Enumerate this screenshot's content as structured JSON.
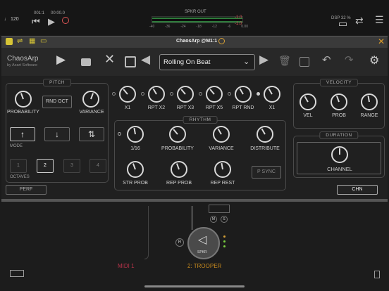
{
  "transport": {
    "tempo": "♩ 120",
    "bar_readout": "001:1",
    "time_readout": "00:00.0",
    "meter_title": "SPKR OUT",
    "meter_scale": [
      "-40",
      "-36",
      "-24",
      "-18",
      "-12",
      "-6",
      "0.00",
      "-1.0",
      "-1.0"
    ],
    "dsp": "DSP 32 %"
  },
  "plugin": {
    "title": "ChaosArp @M1:1",
    "brand": "ChaosArp",
    "brand_sub": "by Axart Software",
    "preset": "Rolling On Beat",
    "accent": "#d6c436"
  },
  "pitch": {
    "title": "PITCH",
    "probability": "PROBABILITY",
    "rnd_oct": "RND OCT",
    "variance": "VARIANCE",
    "mode_label": "MODE",
    "mode_up": "↑",
    "mode_down": "↓",
    "mode_updown": "⇅",
    "octaves_label": "OCTAVES",
    "octaves": [
      "1",
      "2",
      "3",
      "4"
    ],
    "selected_octave": "2"
  },
  "repeat_row": [
    "X1",
    "RPT X2",
    "RPT X3",
    "RPT X5",
    "RPT RND",
    "X1"
  ],
  "rhythm": {
    "title": "RHYTHM",
    "labels": [
      "1/16",
      "PROBABILITY",
      "VARIANCE",
      "DISTRIBUTE",
      "STR PROB",
      "REP PROB",
      "REP REST"
    ],
    "psync": "P SYNC"
  },
  "velocity": {
    "title": "VELOCITY",
    "labels": [
      "VEL",
      "PROB",
      "RANGE"
    ]
  },
  "duration": {
    "title": "DURATION",
    "channel": "CHANNEL"
  },
  "footer": {
    "perf": "PERF",
    "chn": "CHN"
  },
  "graph": {
    "midi": "MIDI 1",
    "trooper": "2: TROOPER",
    "spkr": "SPKR",
    "m": "M",
    "s": "S",
    "r": "R"
  }
}
